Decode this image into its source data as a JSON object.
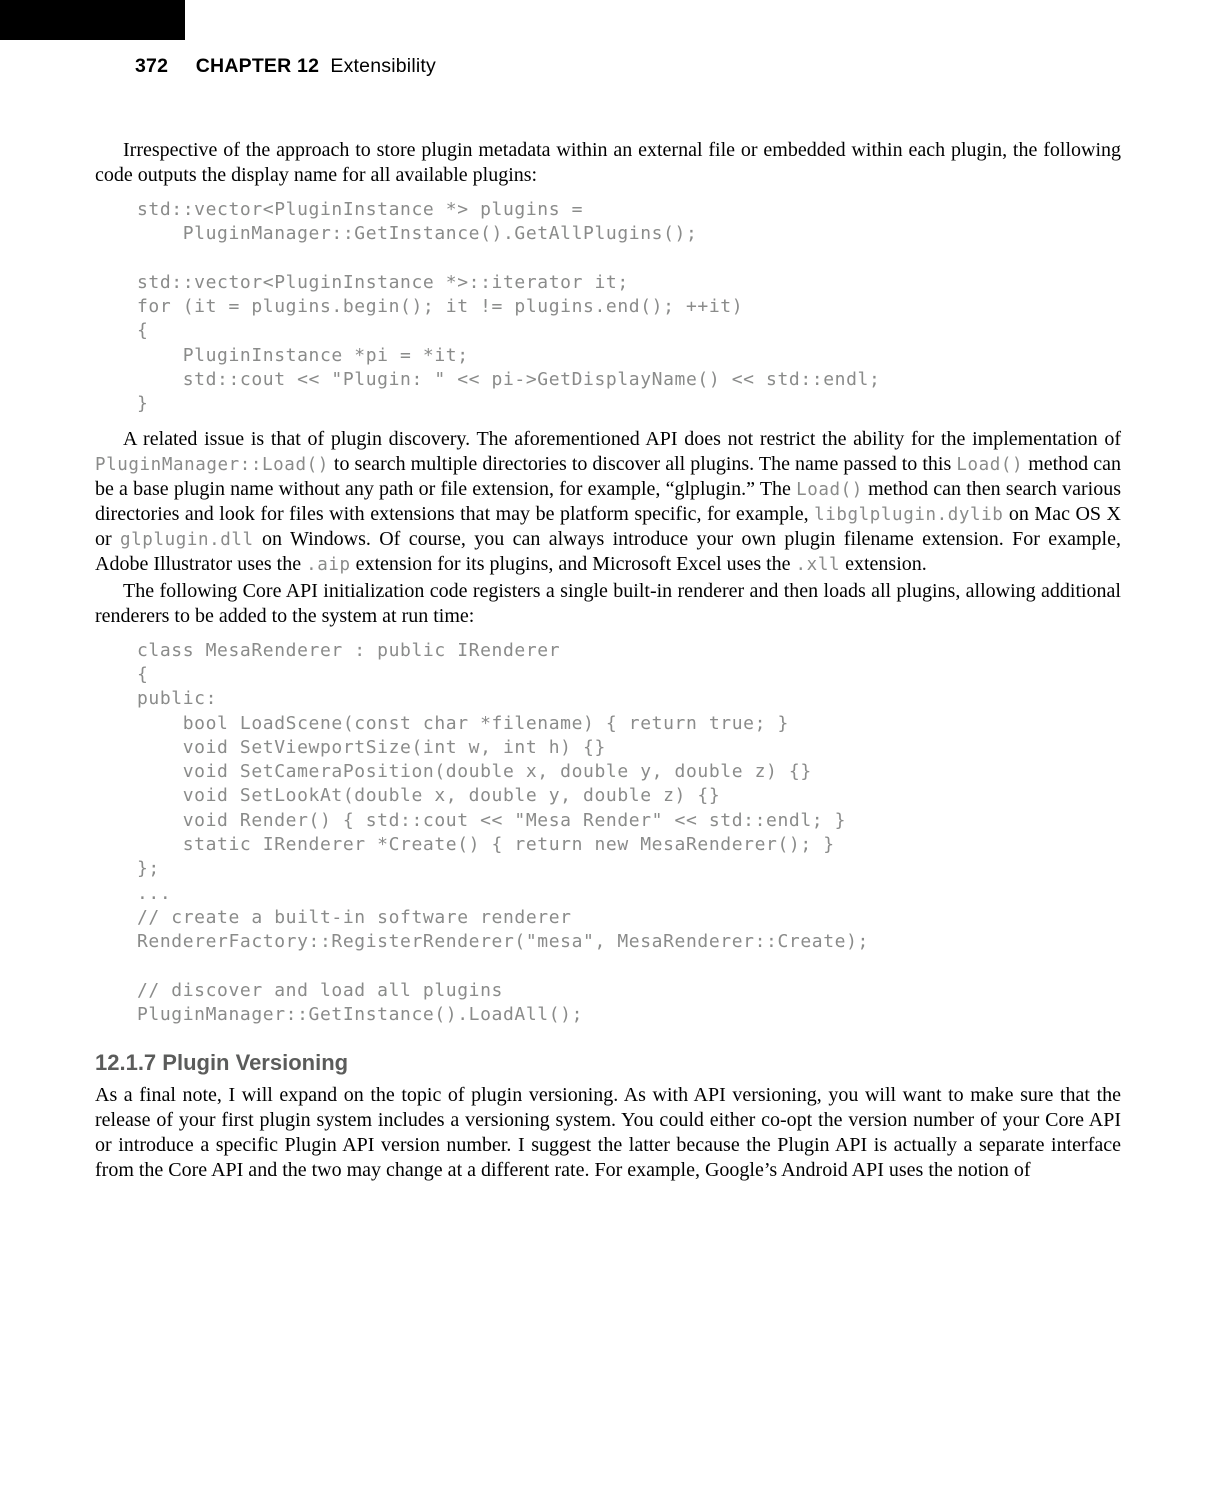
{
  "header": {
    "page_number": "372",
    "chapter_label": "CHAPTER 12",
    "chapter_title": "Extensibility"
  },
  "para1": "Irrespective of the approach to store plugin metadata within an external file or embedded within each plugin, the following code outputs the display name for all available plugins:",
  "code1": "std::vector<PluginInstance *> plugins =\n    PluginManager::GetInstance().GetAllPlugins();\n\nstd::vector<PluginInstance *>::iterator it;\nfor (it = plugins.begin(); it != plugins.end(); ++it)\n{\n    PluginInstance *pi = *it;\n    std::cout << \"Plugin: \" << pi->GetDisplayName() << std::endl;\n}",
  "para2": {
    "t1": "A related issue is that of plugin discovery. The aforementioned API does not restrict the ability for the implementation of ",
    "c1": "PluginManager::Load()",
    "t2": " to search multiple directories to discover all plugins. The name passed to this ",
    "c2": "Load()",
    "t3": " method can be a base plugin name without any path or file extension, for example, “glplugin.” The ",
    "c3": "Load()",
    "t4": " method can then search various directories and look for files with extensions that may be platform specific, for example, ",
    "c4": "libglplugin.dylib",
    "t5": " on Mac OS X or ",
    "c5": "glplugin.dll",
    "t6": " on Windows. Of course, you can always introduce your own plugin filename extension. For example, Adobe Illustrator uses the ",
    "c6": ".aip",
    "t7": " extension for its plugins, and Microsoft Excel uses the ",
    "c7": ".xll",
    "t8": " extension."
  },
  "para3": "The following Core API initialization code registers a single built-in renderer and then loads all plugins, allowing additional renderers to be added to the system at run time:",
  "code2": "class MesaRenderer : public IRenderer\n{\npublic:\n    bool LoadScene(const char *filename) { return true; }\n    void SetViewportSize(int w, int h) {}\n    void SetCameraPosition(double x, double y, double z) {}\n    void SetLookAt(double x, double y, double z) {}\n    void Render() { std::cout << \"Mesa Render\" << std::endl; }\n    static IRenderer *Create() { return new MesaRenderer(); }\n};\n...\n// create a built-in software renderer\nRendererFactory::RegisterRenderer(\"mesa\", MesaRenderer::Create);\n\n// discover and load all plugins\nPluginManager::GetInstance().LoadAll();",
  "section_heading": "12.1.7 Plugin Versioning",
  "para4": "As a final note, I will expand on the topic of plugin versioning. As with API versioning, you will want to make sure that the release of your first plugin system includes a versioning system. You could either co-opt the version number of your Core API or introduce a specific Plugin API version number. I suggest the latter because the Plugin API is actually a separate interface from the Core API and the two may change at a different rate. For example, Google’s Android API uses the notion of"
}
